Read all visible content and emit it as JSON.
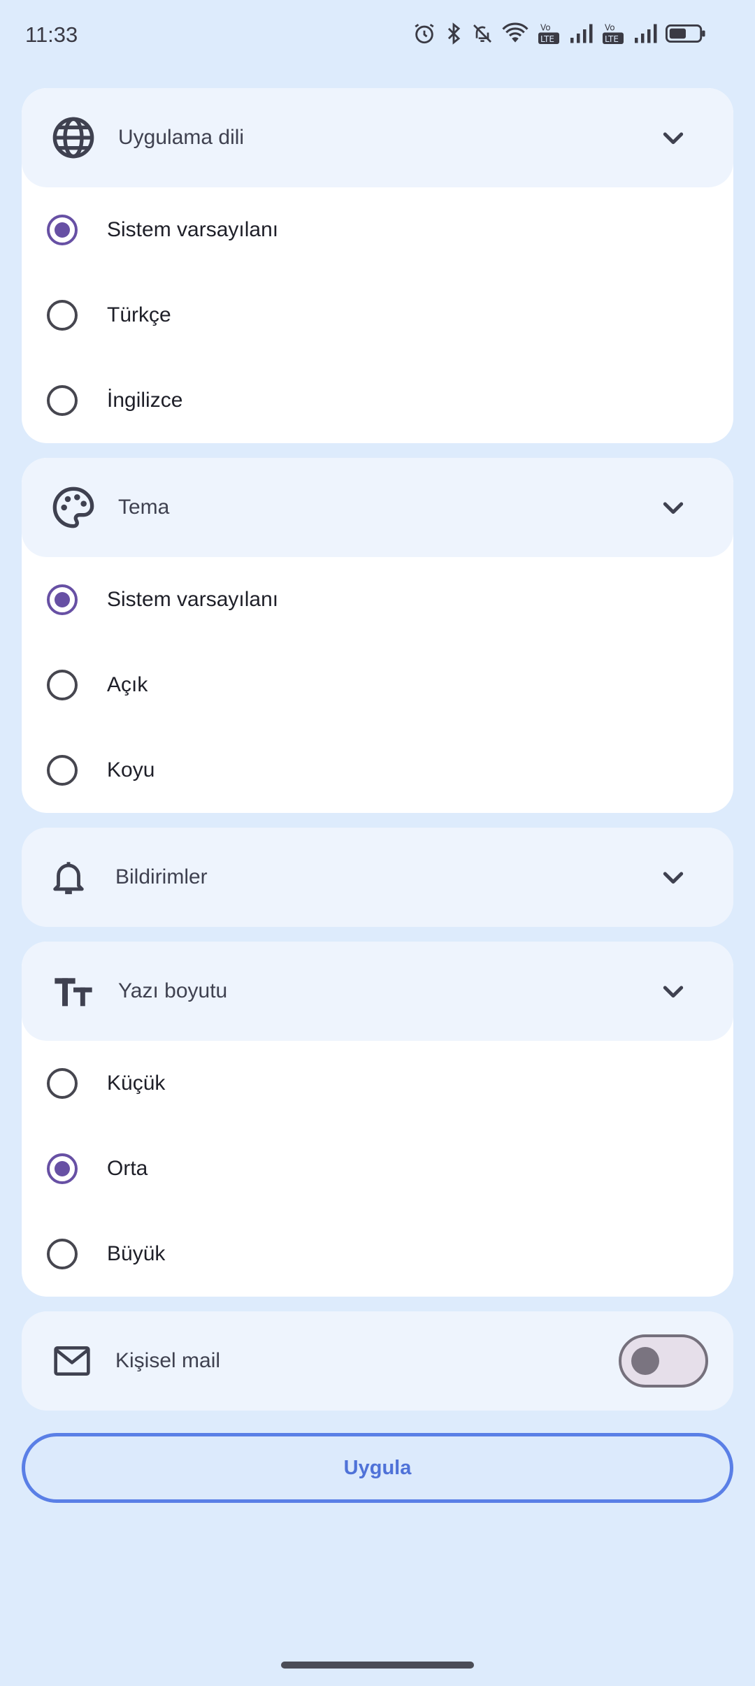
{
  "status_bar": {
    "time": "11:33",
    "icons": [
      "alarm-icon",
      "bluetooth-icon",
      "bell-off-icon",
      "wifi-icon",
      "volte-lte-icon",
      "signal-icon",
      "volte-lte-icon",
      "signal-icon",
      "battery-icon"
    ],
    "battery_level": 0.5
  },
  "language": {
    "title": "Uygulama dili",
    "icon": "globe-icon",
    "options": [
      {
        "label": "Sistem varsayılanı",
        "selected": true
      },
      {
        "label": "Türkçe",
        "selected": false
      },
      {
        "label": "İngilizce",
        "selected": false
      }
    ]
  },
  "theme": {
    "title": "Tema",
    "icon": "palette-icon",
    "options": [
      {
        "label": "Sistem varsayılanı",
        "selected": true
      },
      {
        "label": "Açık",
        "selected": false
      },
      {
        "label": "Koyu",
        "selected": false
      }
    ]
  },
  "notifications": {
    "title": "Bildirimler",
    "icon": "bell-icon"
  },
  "font_size": {
    "title": "Yazı boyutu",
    "icon": "text-size-icon",
    "options": [
      {
        "label": "Küçük",
        "selected": false
      },
      {
        "label": "Orta",
        "selected": true
      },
      {
        "label": "Büyük",
        "selected": false
      }
    ]
  },
  "personal_mail": {
    "title": "Kişisel mail",
    "icon": "mail-icon",
    "enabled": false
  },
  "apply_label": "Uygula",
  "colors": {
    "background": "#DDEBFC",
    "header": "#EEF4FD",
    "accent": "#6750A4",
    "button_border": "#5A7FE6"
  }
}
